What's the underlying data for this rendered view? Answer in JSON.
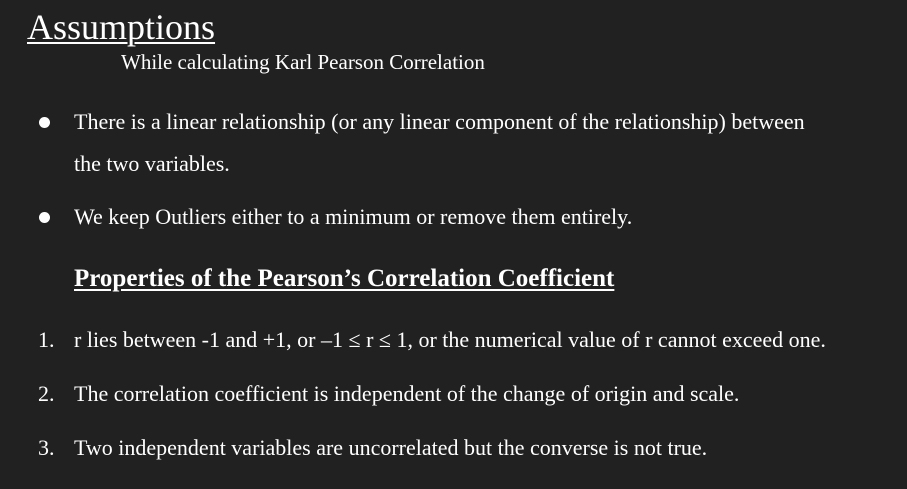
{
  "slide": {
    "title": "Assumptions",
    "subtitle": "While calculating Karl Pearson Correlation",
    "assumptions": [
      {
        "lines": [
          "There is a linear relationship (or any linear component of the relationship) between",
          "the two variables."
        ]
      },
      {
        "lines": [
          "We keep Outliers either to a minimum or remove them entirely."
        ]
      }
    ],
    "properties_heading": "Properties of the Pearson’s Correlation Coefficient",
    "properties": [
      {
        "number": "1.",
        "text": "r lies between -1 and +1, or –1 ≤ r ≤ 1, or the numerical value of r cannot exceed one."
      },
      {
        "number": "2.",
        "text": "The correlation coefficient is independent of the change of origin and scale."
      },
      {
        "number": "3.",
        "text": "Two independent variables are uncorrelated but the converse is not true."
      }
    ]
  }
}
